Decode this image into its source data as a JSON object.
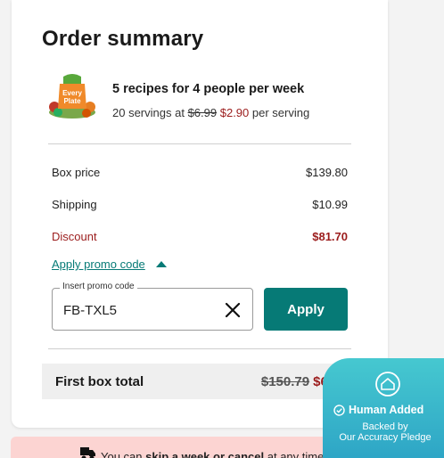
{
  "summary": {
    "title": "Order summary",
    "product_title": "5 recipes for 4 people per week",
    "servings_prefix": "20 servings at",
    "old_serving_price": "$6.99",
    "new_serving_price": "$2.90",
    "servings_suffix": "per serving",
    "image_label": "Every Plate"
  },
  "lines": [
    {
      "label": "Box price",
      "value": "$139.80"
    },
    {
      "label": "Shipping",
      "value": "$10.99"
    },
    {
      "label": "Discount",
      "value": "$81.70"
    }
  ],
  "promo": {
    "link_label": "Apply promo code",
    "field_label": "Insert promo code",
    "value": "FB-TXL5",
    "apply_label": "Apply"
  },
  "total": {
    "label": "First box total",
    "old_value": "$150.79",
    "new_value": "$69.09"
  },
  "banner": {
    "prefix": "You can",
    "bold": "skip a week or cancel",
    "suffix": "at any time"
  },
  "pledge": {
    "title": "Human Added",
    "line1": "Backed by",
    "line2": "Our Accuracy Pledge"
  },
  "colors": {
    "accent": "#067a76",
    "discount": "#9b1c1c",
    "banner": "#fcd4d2",
    "pledge": "#46c8d0"
  }
}
